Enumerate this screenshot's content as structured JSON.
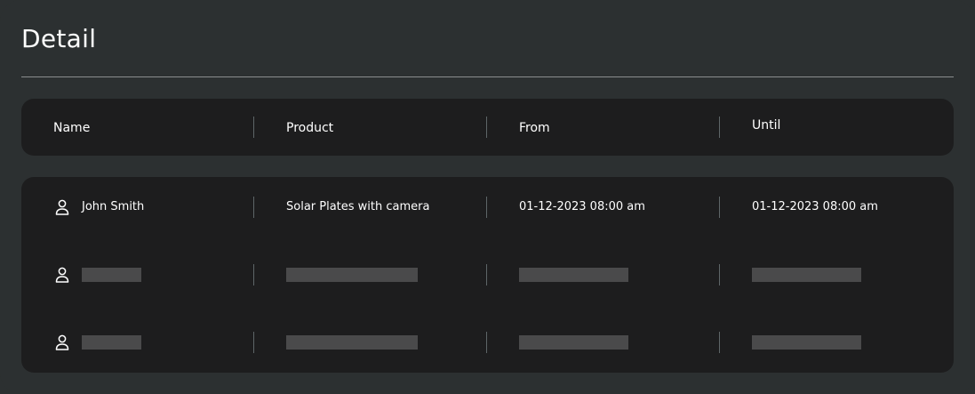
{
  "title": "Detail",
  "columns": [
    "Name",
    "Product",
    "From",
    "Until"
  ],
  "rows": [
    {
      "name": "John Smith",
      "product": "Solar Plates with camera",
      "from": "01-12-2023 08:00 am",
      "until": "01-12-2023 08:00 am"
    }
  ],
  "placeholder_rows": 2,
  "icons": {
    "row_icon": "user-icon"
  },
  "colors": {
    "background": "#2c3031",
    "card": "#1d1d1e",
    "placeholder": "#4a4a4b",
    "text": "#ffffff"
  }
}
